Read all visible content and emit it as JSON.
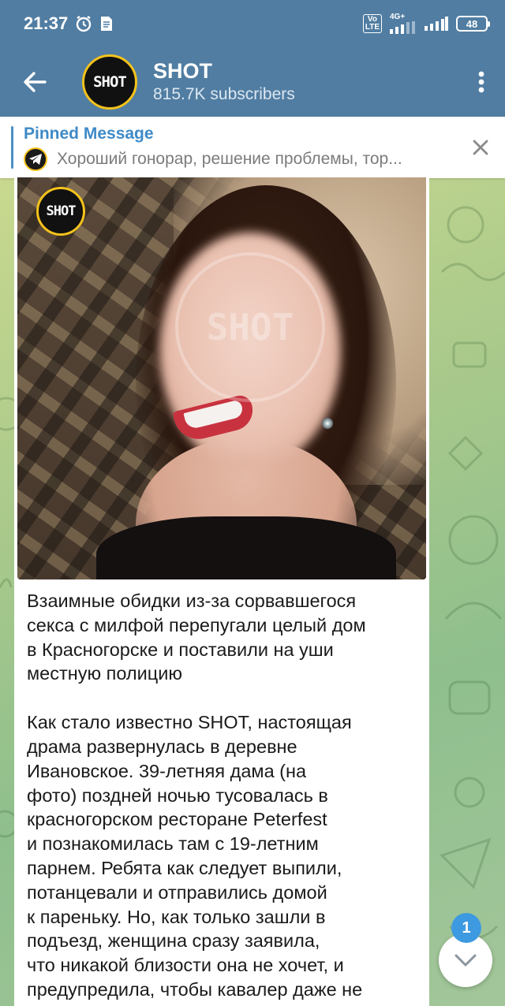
{
  "status_bar": {
    "time": "21:37",
    "network_labels": [
      "Vo",
      "LTE",
      "4G+"
    ],
    "battery": "48"
  },
  "header": {
    "title": "SHOT",
    "subtitle": "815.7K subscribers",
    "avatar_logo_text": "SHOT",
    "accent_color": "#517da2"
  },
  "pinned": {
    "title": "Pinned Message",
    "preview": "Хороший гонорар, решение проблемы, тор..."
  },
  "message": {
    "photo_logo_text": "SHOT",
    "photo_watermark_text": "SHOT",
    "paragraphs": [
      "Взаимные обидки из-за сорвавшегося\nсекса с милфой перепугали целый дом\nв Красногорске и поставили на уши\nместную полицию",
      "Как стало известно SHOT, настоящая\nдрама развернулась в деревне\nИвановское. 39-летняя дама (на\nфото) поздней ночью тусовалась в\nкрасногорском ресторане Peterfest\nи познакомилась там с 19-летним\nпарнем. Ребята как следует выпили,\nпотанцевали и отправились домой\nк пареньку. Но, как только зашли в\nподъезд, женщина сразу заявила,\nчто никакой близости она не хочет, и\nпредупредила, чтобы кавалер даже не"
    ]
  },
  "scroll_down": {
    "unread_count": "1"
  }
}
